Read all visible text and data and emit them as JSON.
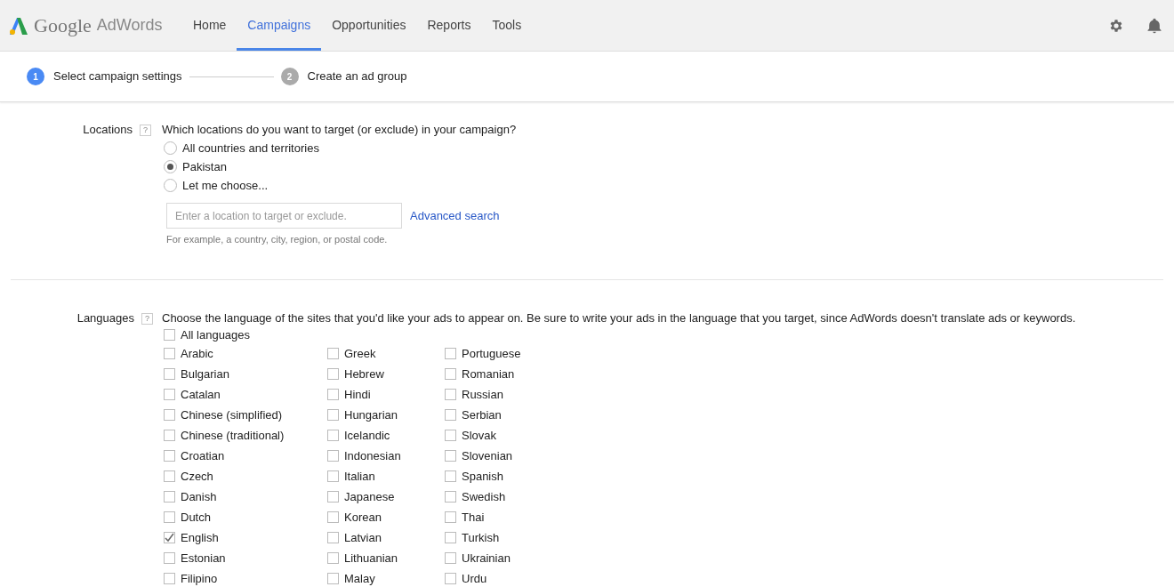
{
  "header": {
    "logo": {
      "brand": "Google",
      "product": "AdWords"
    },
    "nav": [
      {
        "label": "Home",
        "selected": false
      },
      {
        "label": "Campaigns",
        "selected": true
      },
      {
        "label": "Opportunities",
        "selected": false
      },
      {
        "label": "Reports",
        "selected": false
      },
      {
        "label": "Tools",
        "selected": false
      }
    ]
  },
  "steps": [
    {
      "number": "1",
      "label": "Select campaign settings",
      "selected": true
    },
    {
      "number": "2",
      "label": "Create an ad group",
      "selected": false
    }
  ],
  "locations": {
    "label": "Locations",
    "help": "?",
    "question": "Which locations do you want to target (or exclude) in your campaign?",
    "options": [
      {
        "label": "All countries and territories",
        "selected": false
      },
      {
        "label": "Pakistan",
        "selected": true
      },
      {
        "label": "Let me choose...",
        "selected": false
      }
    ],
    "search": {
      "placeholder": "Enter a location to target or exclude."
    },
    "advanced_link": "Advanced search",
    "hint": "For example, a country, city, region, or postal code."
  },
  "languages": {
    "label": "Languages",
    "help": "?",
    "question": "Choose the language of the sites that you'd like your ads to appear on. Be sure to write your ads in the language that you target, since AdWords doesn't translate ads or keywords.",
    "all": {
      "label": "All languages",
      "checked": false
    },
    "columns": [
      [
        {
          "label": "Arabic",
          "checked": false
        },
        {
          "label": "Bulgarian",
          "checked": false
        },
        {
          "label": "Catalan",
          "checked": false
        },
        {
          "label": "Chinese (simplified)",
          "checked": false
        },
        {
          "label": "Chinese (traditional)",
          "checked": false
        },
        {
          "label": "Croatian",
          "checked": false
        },
        {
          "label": "Czech",
          "checked": false
        },
        {
          "label": "Danish",
          "checked": false
        },
        {
          "label": "Dutch",
          "checked": false
        },
        {
          "label": "English",
          "checked": true
        },
        {
          "label": "Estonian",
          "checked": false
        },
        {
          "label": "Filipino",
          "checked": false
        }
      ],
      [
        {
          "label": "Greek",
          "checked": false
        },
        {
          "label": "Hebrew",
          "checked": false
        },
        {
          "label": "Hindi",
          "checked": false
        },
        {
          "label": "Hungarian",
          "checked": false
        },
        {
          "label": "Icelandic",
          "checked": false
        },
        {
          "label": "Indonesian",
          "checked": false
        },
        {
          "label": "Italian",
          "checked": false
        },
        {
          "label": "Japanese",
          "checked": false
        },
        {
          "label": "Korean",
          "checked": false
        },
        {
          "label": "Latvian",
          "checked": false
        },
        {
          "label": "Lithuanian",
          "checked": false
        },
        {
          "label": "Malay",
          "checked": false
        }
      ],
      [
        {
          "label": "Portuguese",
          "checked": false
        },
        {
          "label": "Romanian",
          "checked": false
        },
        {
          "label": "Russian",
          "checked": false
        },
        {
          "label": "Serbian",
          "checked": false
        },
        {
          "label": "Slovak",
          "checked": false
        },
        {
          "label": "Slovenian",
          "checked": false
        },
        {
          "label": "Spanish",
          "checked": false
        },
        {
          "label": "Swedish",
          "checked": false
        },
        {
          "label": "Thai",
          "checked": false
        },
        {
          "label": "Turkish",
          "checked": false
        },
        {
          "label": "Ukrainian",
          "checked": false
        },
        {
          "label": "Urdu",
          "checked": false
        }
      ]
    ]
  }
}
